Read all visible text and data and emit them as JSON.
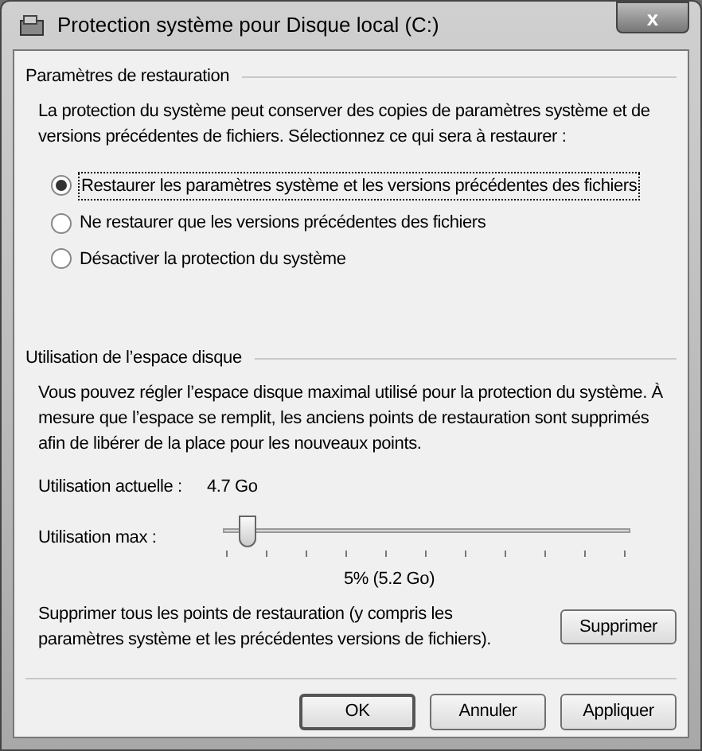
{
  "window": {
    "title": "Protection système pour Disque local (C:)",
    "close": "x"
  },
  "restore": {
    "heading": "Paramètres de restauration",
    "description": "La protection du système peut conserver des copies de paramètres système et de versions précédentes de fichiers. Sélectionnez ce qui sera à restaurer :",
    "options": [
      {
        "label": "Restaurer les paramètres système et les versions précédentes des fichiers",
        "selected": true
      },
      {
        "label": "Ne restaurer que les versions précédentes des fichiers",
        "selected": false
      },
      {
        "label": "Désactiver la protection du système",
        "selected": false
      }
    ]
  },
  "disk": {
    "heading": "Utilisation de l’espace disque",
    "description": "Vous pouvez régler l’espace disque maximal utilisé pour la protection du système. À mesure que l’espace se remplit, les anciens points de restauration sont supprimés afin de libérer de la place pour les nouveaux points.",
    "current_label": "Utilisation actuelle :",
    "current_value": "4.7 Go",
    "max_label": "Utilisation max :",
    "slider": {
      "level": 0.05
    },
    "max_value": "5% (5.2 Go)",
    "delete_text": "Supprimer tous les points de restauration (y compris les paramètres système et les précédentes versions de fichiers).",
    "delete_button": "Supprimer"
  },
  "buttons": [
    {
      "label": "OK",
      "default": true
    },
    {
      "label": "Annuler",
      "default": false
    },
    {
      "label": "Appliquer",
      "default": false
    }
  ]
}
